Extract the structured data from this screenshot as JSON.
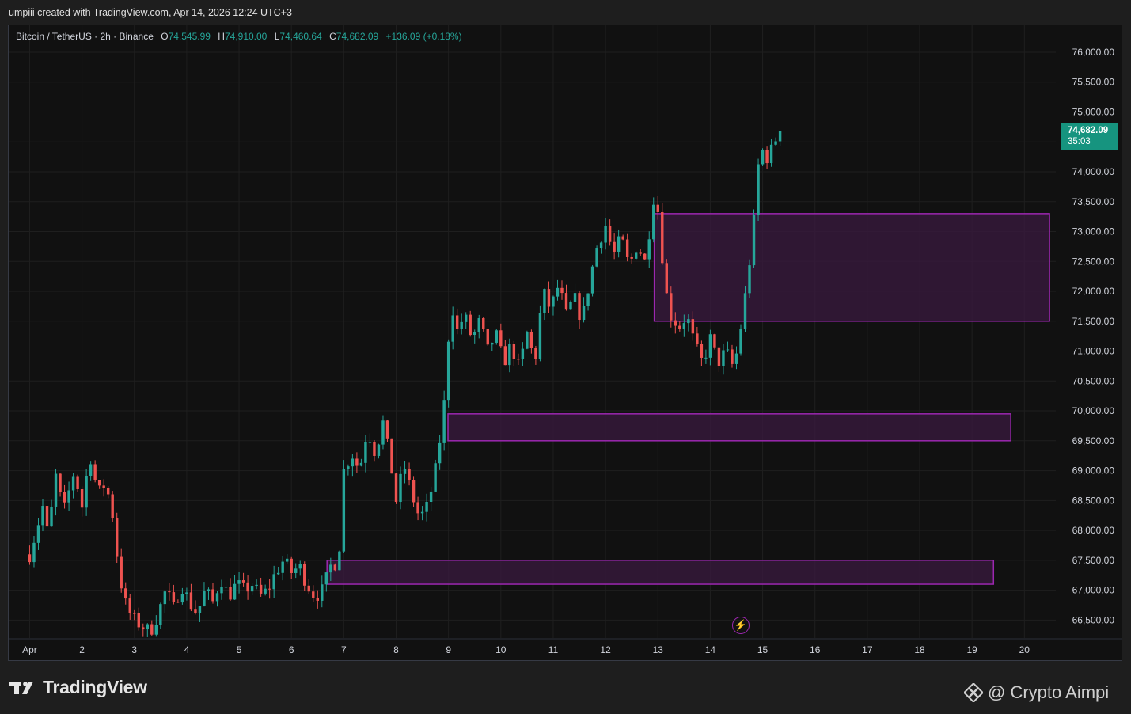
{
  "header": {
    "credit": "umpiii created with TradingView.com, Apr 14, 2026 12:24 UTC+3"
  },
  "legend": {
    "symbol": "Bitcoin / TetherUS · 2h · Binance",
    "o_label": "O",
    "o_value": "74,545.99",
    "h_label": "H",
    "h_value": "74,910.00",
    "l_label": "L",
    "l_value": "74,460.64",
    "c_label": "C",
    "c_value": "74,682.09",
    "change": "+136.09 (+0.18%)"
  },
  "price_tag": {
    "price": "74,682.09",
    "countdown": "35:03"
  },
  "colors": {
    "up": "#26a69a",
    "down": "#ef5350",
    "zone_border": "#9c27b0",
    "zone_fill": "#3a1a3f",
    "background": "#111111",
    "grid": "#1f1f1f"
  },
  "footer": {
    "brand": "TradingView",
    "watermark": "@ Crypto Aimpi"
  },
  "chart_data": {
    "type": "candlestick",
    "timeframe": "2h",
    "x_ticks": [
      "Apr",
      "2",
      "3",
      "4",
      "5",
      "6",
      "7",
      "8",
      "9",
      "10",
      "11",
      "12",
      "13",
      "14",
      "15",
      "16",
      "17",
      "18",
      "19",
      "20"
    ],
    "y_ticks": [
      "66,500.00",
      "67,000.00",
      "67,500.00",
      "68,000.00",
      "68,500.00",
      "69,000.00",
      "69,500.00",
      "70,000.00",
      "70,500.00",
      "71,000.00",
      "71,500.00",
      "72,000.00",
      "72,500.00",
      "73,000.00",
      "73,500.00",
      "74,000.00",
      "74,500.00",
      "75,000.00",
      "75,500.00",
      "76,000.00"
    ],
    "y_values": [
      66500,
      67000,
      67500,
      68000,
      68500,
      69000,
      69500,
      70000,
      70500,
      71000,
      71500,
      72000,
      72500,
      73000,
      73500,
      74000,
      74500,
      75000,
      75500,
      76000
    ],
    "ylim": [
      66200,
      76450
    ],
    "xlim_days": [
      -0.4,
      19.6
    ],
    "last_price": 74682.09,
    "zones": [
      {
        "x_start_day": 11.93,
        "x_end_day": 19.48,
        "low": 71500,
        "high": 73300
      },
      {
        "x_start_day": 7.99,
        "x_end_day": 18.74,
        "low": 69500,
        "high": 69950
      },
      {
        "x_start_day": 5.68,
        "x_end_day": 18.41,
        "low": 67100,
        "high": 67500
      }
    ],
    "path": [
      [
        0.0,
        67600
      ],
      [
        0.25,
        68400
      ],
      [
        0.35,
        67900
      ],
      [
        0.5,
        68900
      ],
      [
        0.65,
        68300
      ],
      [
        0.85,
        69000
      ],
      [
        1.0,
        68400
      ],
      [
        1.15,
        69300
      ],
      [
        1.3,
        68600
      ],
      [
        1.45,
        68800
      ],
      [
        1.6,
        68200
      ],
      [
        1.7,
        67300
      ],
      [
        1.85,
        66700
      ],
      [
        2.0,
        66500
      ],
      [
        2.15,
        66400
      ],
      [
        2.3,
        66300
      ],
      [
        2.45,
        66600
      ],
      [
        2.6,
        67000
      ],
      [
        2.75,
        66700
      ],
      [
        2.9,
        67100
      ],
      [
        3.05,
        66800
      ],
      [
        3.2,
        66600
      ],
      [
        3.35,
        67000
      ],
      [
        3.5,
        66800
      ],
      [
        3.65,
        67200
      ],
      [
        3.8,
        66900
      ],
      [
        3.95,
        67100
      ],
      [
        4.1,
        67000
      ],
      [
        4.25,
        67100
      ],
      [
        4.4,
        66900
      ],
      [
        4.55,
        67000
      ],
      [
        4.7,
        67300
      ],
      [
        4.85,
        67500
      ],
      [
        5.0,
        67300
      ],
      [
        5.15,
        67400
      ],
      [
        5.3,
        67100
      ],
      [
        5.45,
        66900
      ],
      [
        5.6,
        67000
      ],
      [
        5.75,
        67400
      ],
      [
        5.9,
        67500
      ],
      [
        6.0,
        69000
      ],
      [
        6.15,
        69300
      ],
      [
        6.3,
        69000
      ],
      [
        6.45,
        69700
      ],
      [
        6.6,
        69300
      ],
      [
        6.75,
        69800
      ],
      [
        6.9,
        69100
      ],
      [
        7.0,
        68500
      ],
      [
        7.15,
        69100
      ],
      [
        7.3,
        68600
      ],
      [
        7.45,
        68200
      ],
      [
        7.6,
        68400
      ],
      [
        7.75,
        69000
      ],
      [
        7.9,
        69900
      ],
      [
        8.05,
        71900
      ],
      [
        8.15,
        71300
      ],
      [
        8.3,
        71600
      ],
      [
        8.45,
        71200
      ],
      [
        8.6,
        71500
      ],
      [
        8.75,
        71000
      ],
      [
        8.9,
        71300
      ],
      [
        9.05,
        70800
      ],
      [
        9.2,
        71100
      ],
      [
        9.35,
        70700
      ],
      [
        9.5,
        71300
      ],
      [
        9.65,
        70800
      ],
      [
        9.8,
        72000
      ],
      [
        9.95,
        71700
      ],
      [
        10.1,
        72100
      ],
      [
        10.25,
        71600
      ],
      [
        10.4,
        71900
      ],
      [
        10.55,
        71500
      ],
      [
        10.7,
        72200
      ],
      [
        10.85,
        72800
      ],
      [
        11.0,
        73100
      ],
      [
        11.15,
        72600
      ],
      [
        11.3,
        72900
      ],
      [
        11.45,
        72400
      ],
      [
        11.6,
        72800
      ],
      [
        11.75,
        72500
      ],
      [
        11.85,
        73100
      ],
      [
        11.95,
        73800
      ],
      [
        12.05,
        72900
      ],
      [
        12.15,
        72000
      ],
      [
        12.25,
        71600
      ],
      [
        12.4,
        71400
      ],
      [
        12.55,
        71600
      ],
      [
        12.7,
        71100
      ],
      [
        12.85,
        70800
      ],
      [
        13.0,
        71200
      ],
      [
        13.15,
        70800
      ],
      [
        13.3,
        71000
      ],
      [
        13.45,
        70700
      ],
      [
        13.55,
        71200
      ],
      [
        13.65,
        71800
      ],
      [
        13.75,
        72500
      ],
      [
        13.85,
        73300
      ],
      [
        13.95,
        74500
      ],
      [
        14.05,
        74200
      ],
      [
        14.2,
        74400
      ],
      [
        14.3,
        74700
      ],
      [
        14.35,
        74682
      ]
    ]
  }
}
